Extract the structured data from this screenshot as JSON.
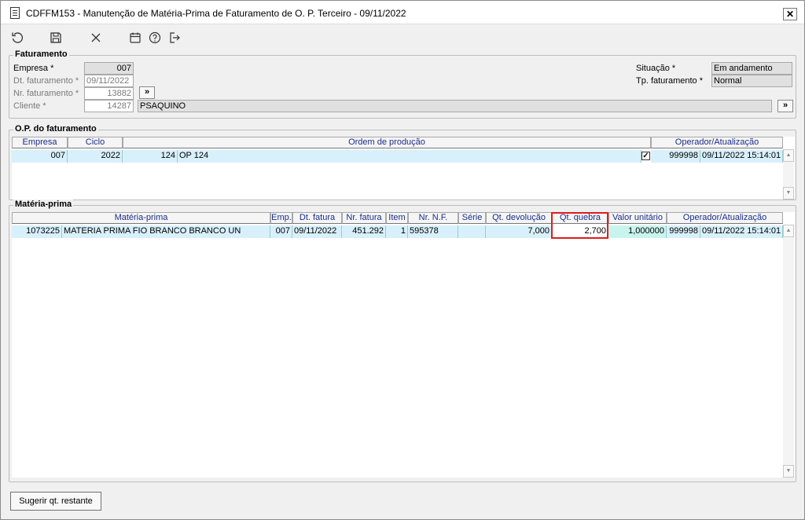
{
  "window": {
    "title": "CDFFM153 - Manutenção de Matéria-Prima de Faturamento de O. P. Terceiro - 09/11/2022",
    "close": "✕"
  },
  "toolbar": {
    "icons": [
      "refresh-icon",
      "save-icon",
      "close-icon",
      "calendar-icon",
      "help-icon",
      "exit-icon"
    ]
  },
  "faturamento": {
    "title": "Faturamento",
    "empresa_label": "Empresa *",
    "empresa_value": "007",
    "dt_label": "Dt. faturamento *",
    "dt_value": "09/11/2022",
    "nr_label": "Nr. faturamento *",
    "nr_value": "13882",
    "cliente_label": "Cliente *",
    "cliente_code": "14287",
    "cliente_name": "PSAQUINO",
    "situacao_label": "Situação *",
    "situacao_value": "Em andamento",
    "tp_label": "Tp. faturamento *",
    "tp_value": "Normal",
    "expand": "»"
  },
  "op": {
    "title": "O.P. do faturamento",
    "headers": [
      "Empresa",
      "Ciclo",
      "Ordem de produção",
      "Operador/Atualização"
    ],
    "row": {
      "empresa": "007",
      "ciclo": "2022",
      "ordem_num": "124",
      "ordem_desc": "OP 124",
      "check": "✓",
      "operador": "999998",
      "atualizacao": "09/11/2022 15:14:01"
    }
  },
  "mp": {
    "title": "Matéria-prima",
    "headers": [
      "Matéria-prima",
      "Emp.",
      "Dt. fatura",
      "Nr. fatura",
      "Item",
      "Nr. N.F.",
      "Série",
      "Qt. devolução",
      "Qt. quebra",
      "Valor unitário",
      "Operador/Atualização"
    ],
    "row": {
      "codigo": "1073225",
      "descricao": "MATERIA PRIMA FIO BRANCO BRANCO UN",
      "emp": "007",
      "dt_fatura": "09/11/2022",
      "nr_fatura": "451.292",
      "item": "1",
      "nr_nf": "595378",
      "serie": "",
      "qt_devolucao": "7,000",
      "qt_quebra": "2,700",
      "valor_unitario": "1,000000",
      "operador": "999998",
      "atualizacao": "09/11/2022 15:14:01"
    }
  },
  "buttons": {
    "sugerir": "Sugerir qt. restante"
  },
  "scroll": {
    "up": "▲",
    "down": "▼"
  }
}
